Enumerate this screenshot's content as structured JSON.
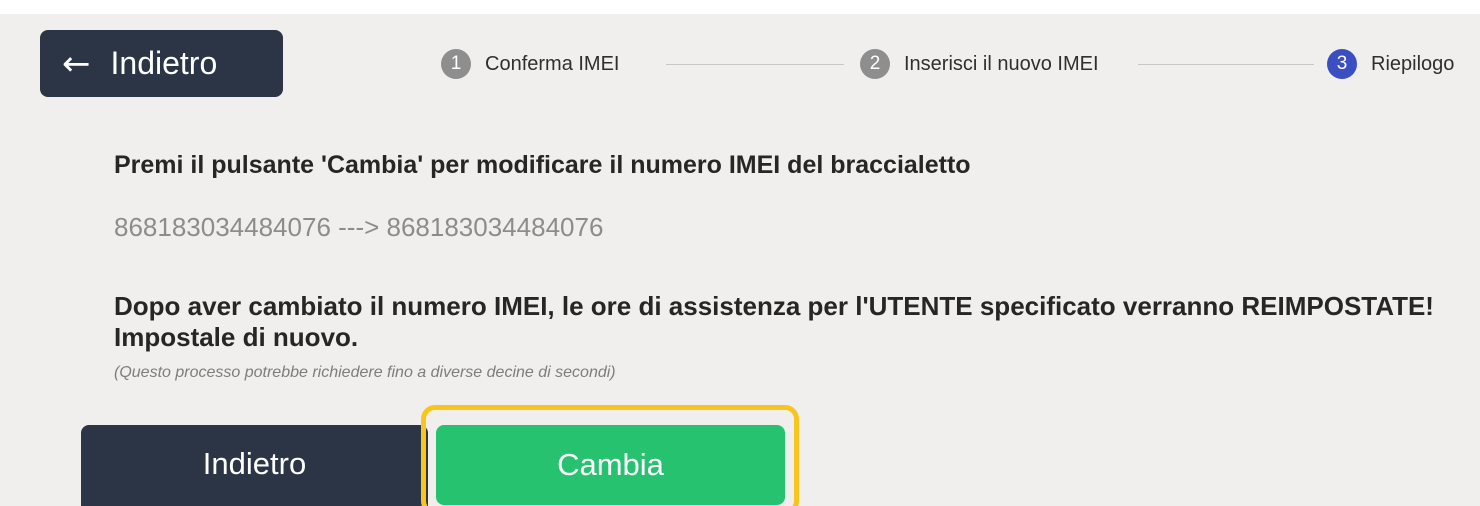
{
  "header": {
    "back_label": "Indietro",
    "back_icon": "arrow-left-icon"
  },
  "stepper": {
    "steps": [
      {
        "number": "1",
        "label": "Conferma IMEI",
        "color": "#8e8e8e"
      },
      {
        "number": "2",
        "label": "Inserisci il nuovo IMEI",
        "color": "#8e8e8e"
      },
      {
        "number": "3",
        "label": "Riepilogo",
        "color": "#3b4fc2"
      }
    ]
  },
  "main": {
    "heading": "Premi il pulsante 'Cambia' per modificare il numero IMEI del braccialetto",
    "imei_change": "868183034484076 ---> 868183034484076",
    "warning": "Dopo aver cambiato il numero IMEI, le ore di assistenza per l'UTENTE specificato verranno REIMPOSTATE! Impostale di nuovo.",
    "note": "(Questo processo potrebbe richiedere fino a diverse decine di secondi)"
  },
  "actions": {
    "back_label": "Indietro",
    "change_label": "Cambia"
  },
  "colors": {
    "dark_button": "#2b3545",
    "change_button": "#27c26f",
    "highlight": "#f7c51c",
    "active_step": "#3b4fc2",
    "inactive_step": "#8e8e8e"
  }
}
